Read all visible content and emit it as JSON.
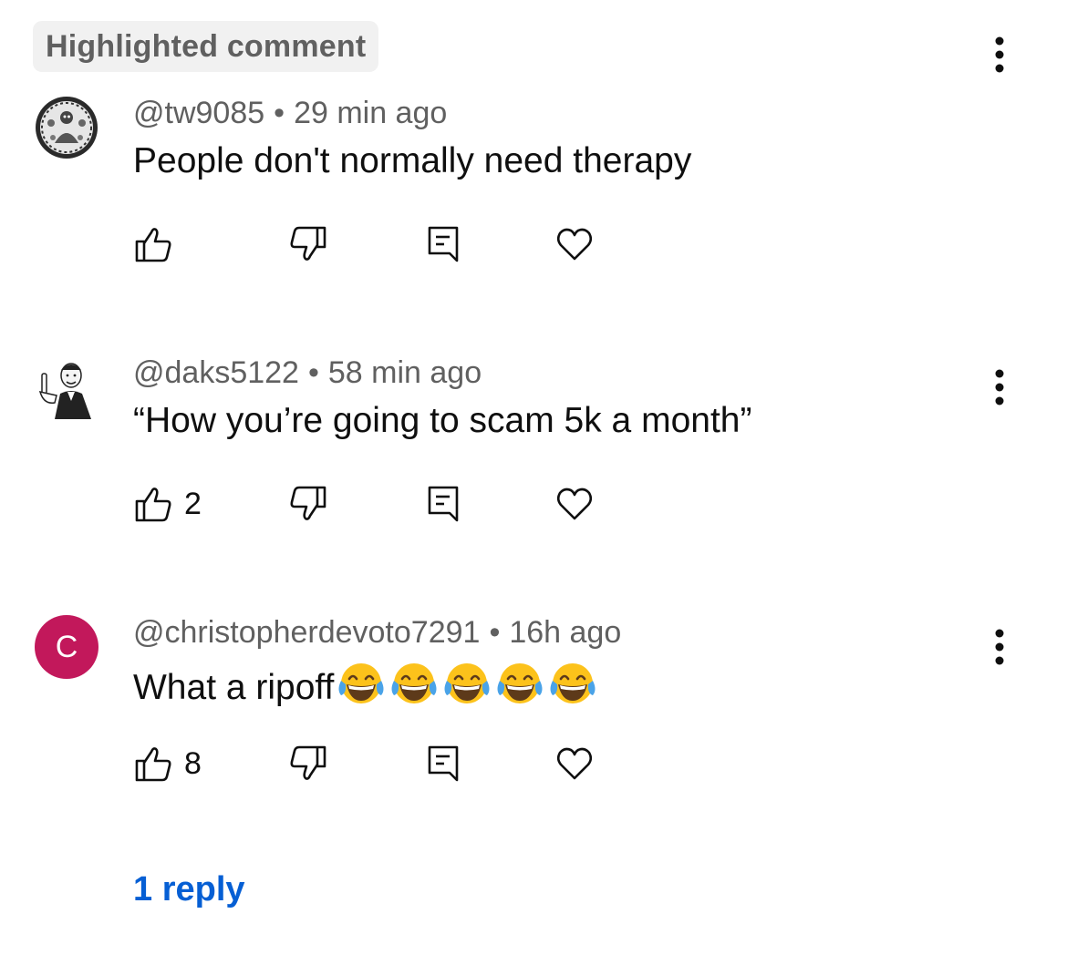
{
  "highlight_badge": "Highlighted comment",
  "comments": [
    {
      "author": "@tw9085",
      "time": "29 min ago",
      "text": "People don't normally need therapy",
      "likes": "",
      "avatar_letter": ""
    },
    {
      "author": "@daks5122",
      "time": "58 min ago",
      "text": "“How you’re going to scam 5k a month”",
      "likes": "2",
      "avatar_letter": ""
    },
    {
      "author": "@christopherdevoto7291",
      "time": "16h ago",
      "text": "What a ripoff",
      "emoji": [
        "tears-of-joy-emoji",
        "tears-of-joy-emoji",
        "tears-of-joy-emoji",
        "tears-of-joy-emoji",
        "tears-of-joy-emoji"
      ],
      "likes": "8",
      "avatar_letter": "C"
    }
  ],
  "separator": "•",
  "reply_link": "1 reply",
  "colors": {
    "meta_text": "#606060",
    "link": "#065fd4",
    "avatar_c": "#c2185b",
    "badge_bg": "#f1f1f1"
  }
}
